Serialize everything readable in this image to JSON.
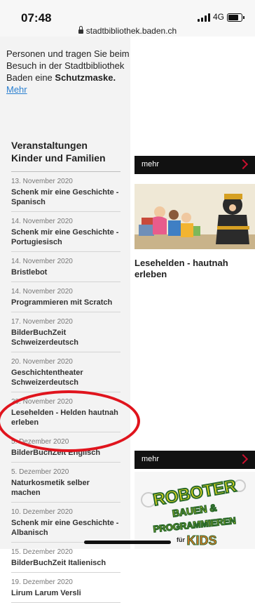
{
  "status": {
    "time": "07:48",
    "network": "4G"
  },
  "browser": {
    "url": "stadtbibliothek.baden.ch"
  },
  "intro": {
    "text": "Personen und tragen Sie beim Besuch in der Stadtbibliothek Baden eine",
    "bold": "Schutzmaske.",
    "link": "Mehr"
  },
  "events": {
    "title": "Veranstaltungen Kinder und Familien",
    "items": [
      {
        "date": "13. November 2020",
        "title": "Schenk mir eine Geschichte - Spanisch"
      },
      {
        "date": "14. November 2020",
        "title": "Schenk mir eine Geschichte - Portugiesisch"
      },
      {
        "date": "14. November 2020",
        "title": "Bristlebot"
      },
      {
        "date": "14. November 2020",
        "title": "Programmieren mit Scratch"
      },
      {
        "date": "17. November 2020",
        "title": "BilderBuchZeit Schweizerdeutsch"
      },
      {
        "date": "20. November 2020",
        "title": "Geschichtentheater Schweizerdeutsch"
      },
      {
        "date": "29. November 2020",
        "title": "Lesehelden - Helden hautnah erleben"
      },
      {
        "date": "5. Dezember 2020",
        "title": "BilderBuchZeit Englisch"
      },
      {
        "date": "5. Dezember 2020",
        "title": "Naturkosmetik selber machen"
      },
      {
        "date": "10. Dezember 2020",
        "title": "Schenk mir eine Geschichte - Albanisch"
      },
      {
        "date": "15. Dezember 2020",
        "title": "BilderBuchZeit Italienisch"
      },
      {
        "date": "19. Dezember 2020",
        "title": "Lirum Larum Versli"
      }
    ]
  },
  "teasers": {
    "more_label": "mehr",
    "teaser1_caption": "Lesehelden - hautnah erleben",
    "teaser2_logo": [
      "ROBOTER",
      "BAUEN &",
      "PROGRAMMIEREN",
      "für",
      "KIDS"
    ]
  }
}
